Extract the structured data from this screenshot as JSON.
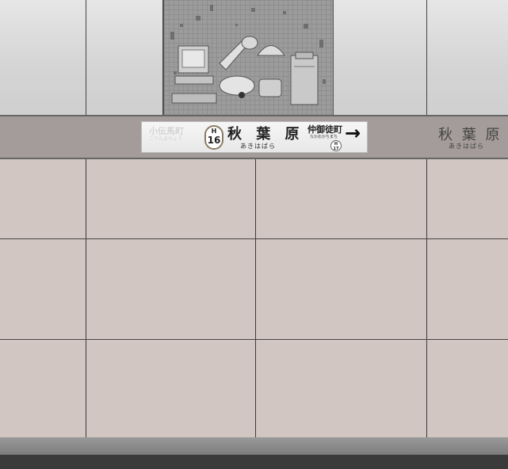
{
  "sign": {
    "prev_station": "小伝馬町",
    "prev_station_kana": "こでんまちょう",
    "line_code": "H",
    "station_number": "16",
    "station_name": "秋 葉 原",
    "station_kana": "あきはばら",
    "next_station": "仲御徒町",
    "next_station_kana": "なかおかちまち",
    "next_line_code": "H",
    "next_station_number": "17",
    "direction_arrow": "→"
  },
  "side_sign": {
    "station_name": "秋 葉 原",
    "station_kana": "あきはばら"
  },
  "colors": {
    "tile": "#d1c6c1",
    "band": "#a39c9a",
    "line_badge_border": "#8a7c62"
  }
}
